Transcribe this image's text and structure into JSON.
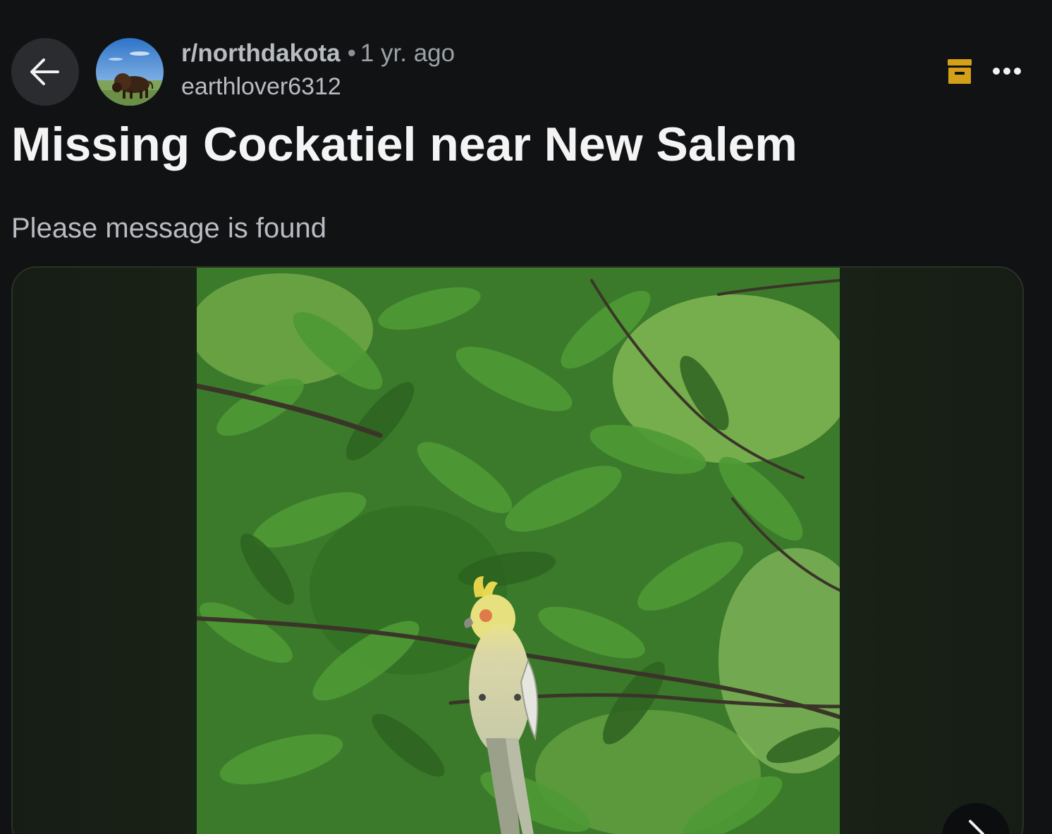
{
  "post": {
    "subreddit": "r/northdakota",
    "separator": "•",
    "age": "1 yr. ago",
    "author": "earthlover6312",
    "title": "Missing Cockatiel near New Salem",
    "body": "Please message is found"
  },
  "icons": {
    "back": "arrow-left-icon",
    "archive": "archive-icon",
    "more": "more-horizontal-icon",
    "next": "chevron-right-icon"
  },
  "colors": {
    "background": "#111214",
    "archive_accent": "#d4a017",
    "title": "#f4f4f5",
    "meta": "#b8bcc2"
  }
}
